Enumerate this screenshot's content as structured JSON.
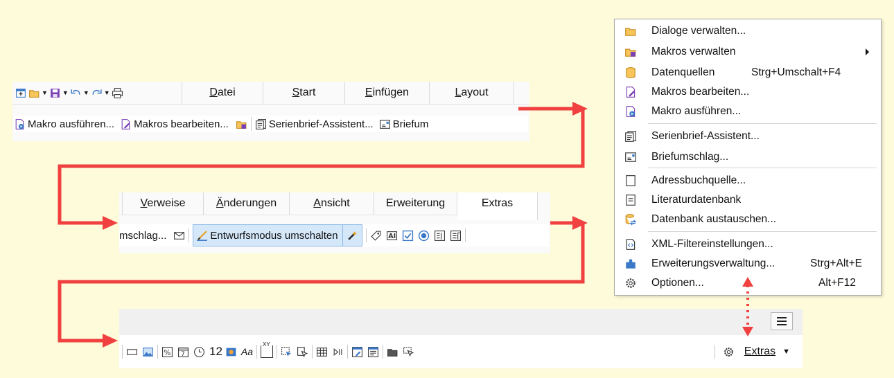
{
  "toolbar1": {
    "tabs": [
      {
        "label": "Datei",
        "pre": "",
        "ul": "D",
        "post": "atei"
      },
      {
        "label": "Start",
        "pre": "",
        "ul": "S",
        "post": "tart"
      },
      {
        "label": "Einfügen",
        "pre": "",
        "ul": "E",
        "post": "infügen"
      },
      {
        "label": "Layout",
        "pre": "",
        "ul": "L",
        "post": "ayout"
      }
    ],
    "buttons": {
      "run_macro": "Makro ausführen...",
      "edit_macros": "Makros bearbeiten...",
      "mail_merge": "Serienbrief-Assistent...",
      "envelope": "Briefum"
    }
  },
  "toolbar2": {
    "tabs": [
      {
        "label": "Verweise",
        "pre": "",
        "ul": "V",
        "post": "erweise"
      },
      {
        "label": "Änderungen",
        "pre": "",
        "ul": "Ä",
        "post": "nderungen"
      },
      {
        "label": "Ansicht",
        "pre": "",
        "ul": "A",
        "post": "nsicht"
      },
      {
        "label": "Erweiterung",
        "pre": "",
        "ul": "",
        "post": "Erweiterung"
      },
      {
        "label": "Extras",
        "pre": "",
        "ul": "",
        "post": "Extras"
      }
    ],
    "buttons": {
      "envelope_partial": "mschlag...",
      "design_mode": "Entwurfsmodus umschalten"
    }
  },
  "toolbar3": {
    "number_label": "12",
    "font_label": "Aa",
    "xy_label": "XY",
    "extras_label": "Extras"
  },
  "menu": {
    "items": [
      {
        "label": "Dialoge verwalten...",
        "shortcut": ""
      },
      {
        "label": "Makros verwalten",
        "shortcut": ""
      },
      {
        "label": "Datenquellen",
        "shortcut": "Strg+Umschalt+F4"
      },
      {
        "label": "Makros bearbeiten...",
        "shortcut": ""
      },
      {
        "label": "Makro ausführen...",
        "shortcut": ""
      },
      {
        "label": "Serienbrief-Assistent...",
        "shortcut": ""
      },
      {
        "label": "Briefumschlag...",
        "shortcut": ""
      },
      {
        "label": "Adressbuchquelle...",
        "shortcut": ""
      },
      {
        "label": "Literaturdatenbank",
        "shortcut": ""
      },
      {
        "label": "Datenbank austauschen...",
        "shortcut": ""
      },
      {
        "label": "XML-Filtereinstellungen...",
        "shortcut": ""
      },
      {
        "label": "Erweiterungsverwaltung...",
        "shortcut": "Strg+Alt+E"
      },
      {
        "label": "Optionen...",
        "shortcut": "Alt+F12"
      }
    ]
  },
  "colors": {
    "background": "#fdfbd9",
    "arrow": "#f04040",
    "accent_blue": "#3a78c8",
    "macro_purple": "#7a3fb5",
    "folder_orange": "#f2a23a",
    "highlight": "#d5e8fa"
  }
}
